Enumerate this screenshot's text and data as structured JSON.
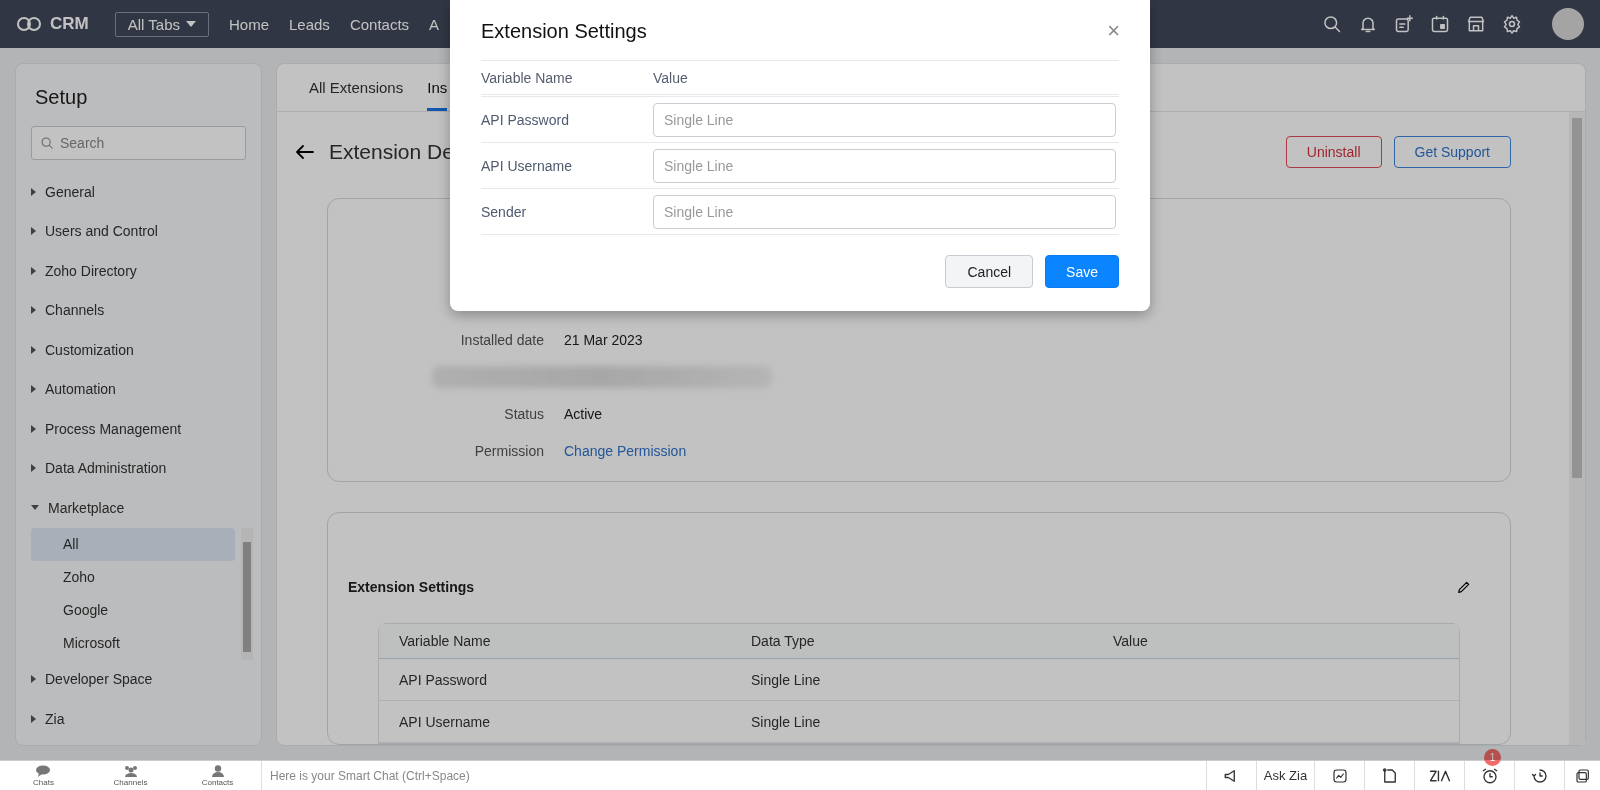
{
  "nav": {
    "logo": "CRM",
    "all_tabs": "All Tabs",
    "links": [
      "Home",
      "Leads",
      "Contacts",
      "A"
    ]
  },
  "sidebar": {
    "title": "Setup",
    "search_placeholder": "Search",
    "items": [
      {
        "label": "General",
        "expanded": false
      },
      {
        "label": "Users and Control",
        "expanded": false
      },
      {
        "label": "Zoho Directory",
        "expanded": false
      },
      {
        "label": "Channels",
        "expanded": false
      },
      {
        "label": "Customization",
        "expanded": false
      },
      {
        "label": "Automation",
        "expanded": false
      },
      {
        "label": "Process Management",
        "expanded": false
      },
      {
        "label": "Data Administration",
        "expanded": false
      },
      {
        "label": "Marketplace",
        "expanded": true,
        "children": [
          {
            "label": "All",
            "selected": true
          },
          {
            "label": "Zoho",
            "selected": false
          },
          {
            "label": "Google",
            "selected": false
          },
          {
            "label": "Microsoft",
            "selected": false
          }
        ]
      },
      {
        "label": "Developer Space",
        "expanded": false
      },
      {
        "label": "Zia",
        "expanded": false
      }
    ]
  },
  "tabs": [
    {
      "label": "All Extensions",
      "selected": false
    },
    {
      "label": "Ins",
      "selected": true
    }
  ],
  "page_title": "Extension De",
  "actions": [
    {
      "label": "Uninstall",
      "kind": "danger"
    },
    {
      "label": "Get Support",
      "kind": "primary"
    }
  ],
  "details": [
    {
      "kind": "text",
      "label": "Installed date",
      "value": "21 Mar 2023"
    },
    {
      "kind": "redacted"
    },
    {
      "kind": "text",
      "label": "Status",
      "value": "Active"
    },
    {
      "kind": "link",
      "label": "Permission",
      "value": "Change Permission"
    }
  ],
  "settings_card": {
    "title": "Extension Settings",
    "columns": [
      "Variable Name",
      "Data Type",
      "Value"
    ],
    "rows": [
      [
        "API Password",
        "Single Line"
      ],
      [
        "API Username",
        "Single Line"
      ]
    ]
  },
  "chat_bar": {
    "tabs": [
      "Chats",
      "Channels",
      "Contacts"
    ],
    "placeholder": "Here is your Smart Chat (Ctrl+Space)",
    "ask_zia": "Ask Zia",
    "alarm_badge": "1"
  },
  "modal": {
    "title": "Extension Settings",
    "close": "×",
    "columns": [
      "Variable Name",
      "Value"
    ],
    "fields": [
      {
        "label": "API Password",
        "placeholder": "Single Line"
      },
      {
        "label": "API Username",
        "placeholder": "Single Line"
      },
      {
        "label": "Sender",
        "placeholder": "Single Line"
      }
    ],
    "buttons": [
      {
        "label": "Cancel",
        "kind": "secondary"
      },
      {
        "label": "Save",
        "kind": "primary"
      }
    ]
  }
}
